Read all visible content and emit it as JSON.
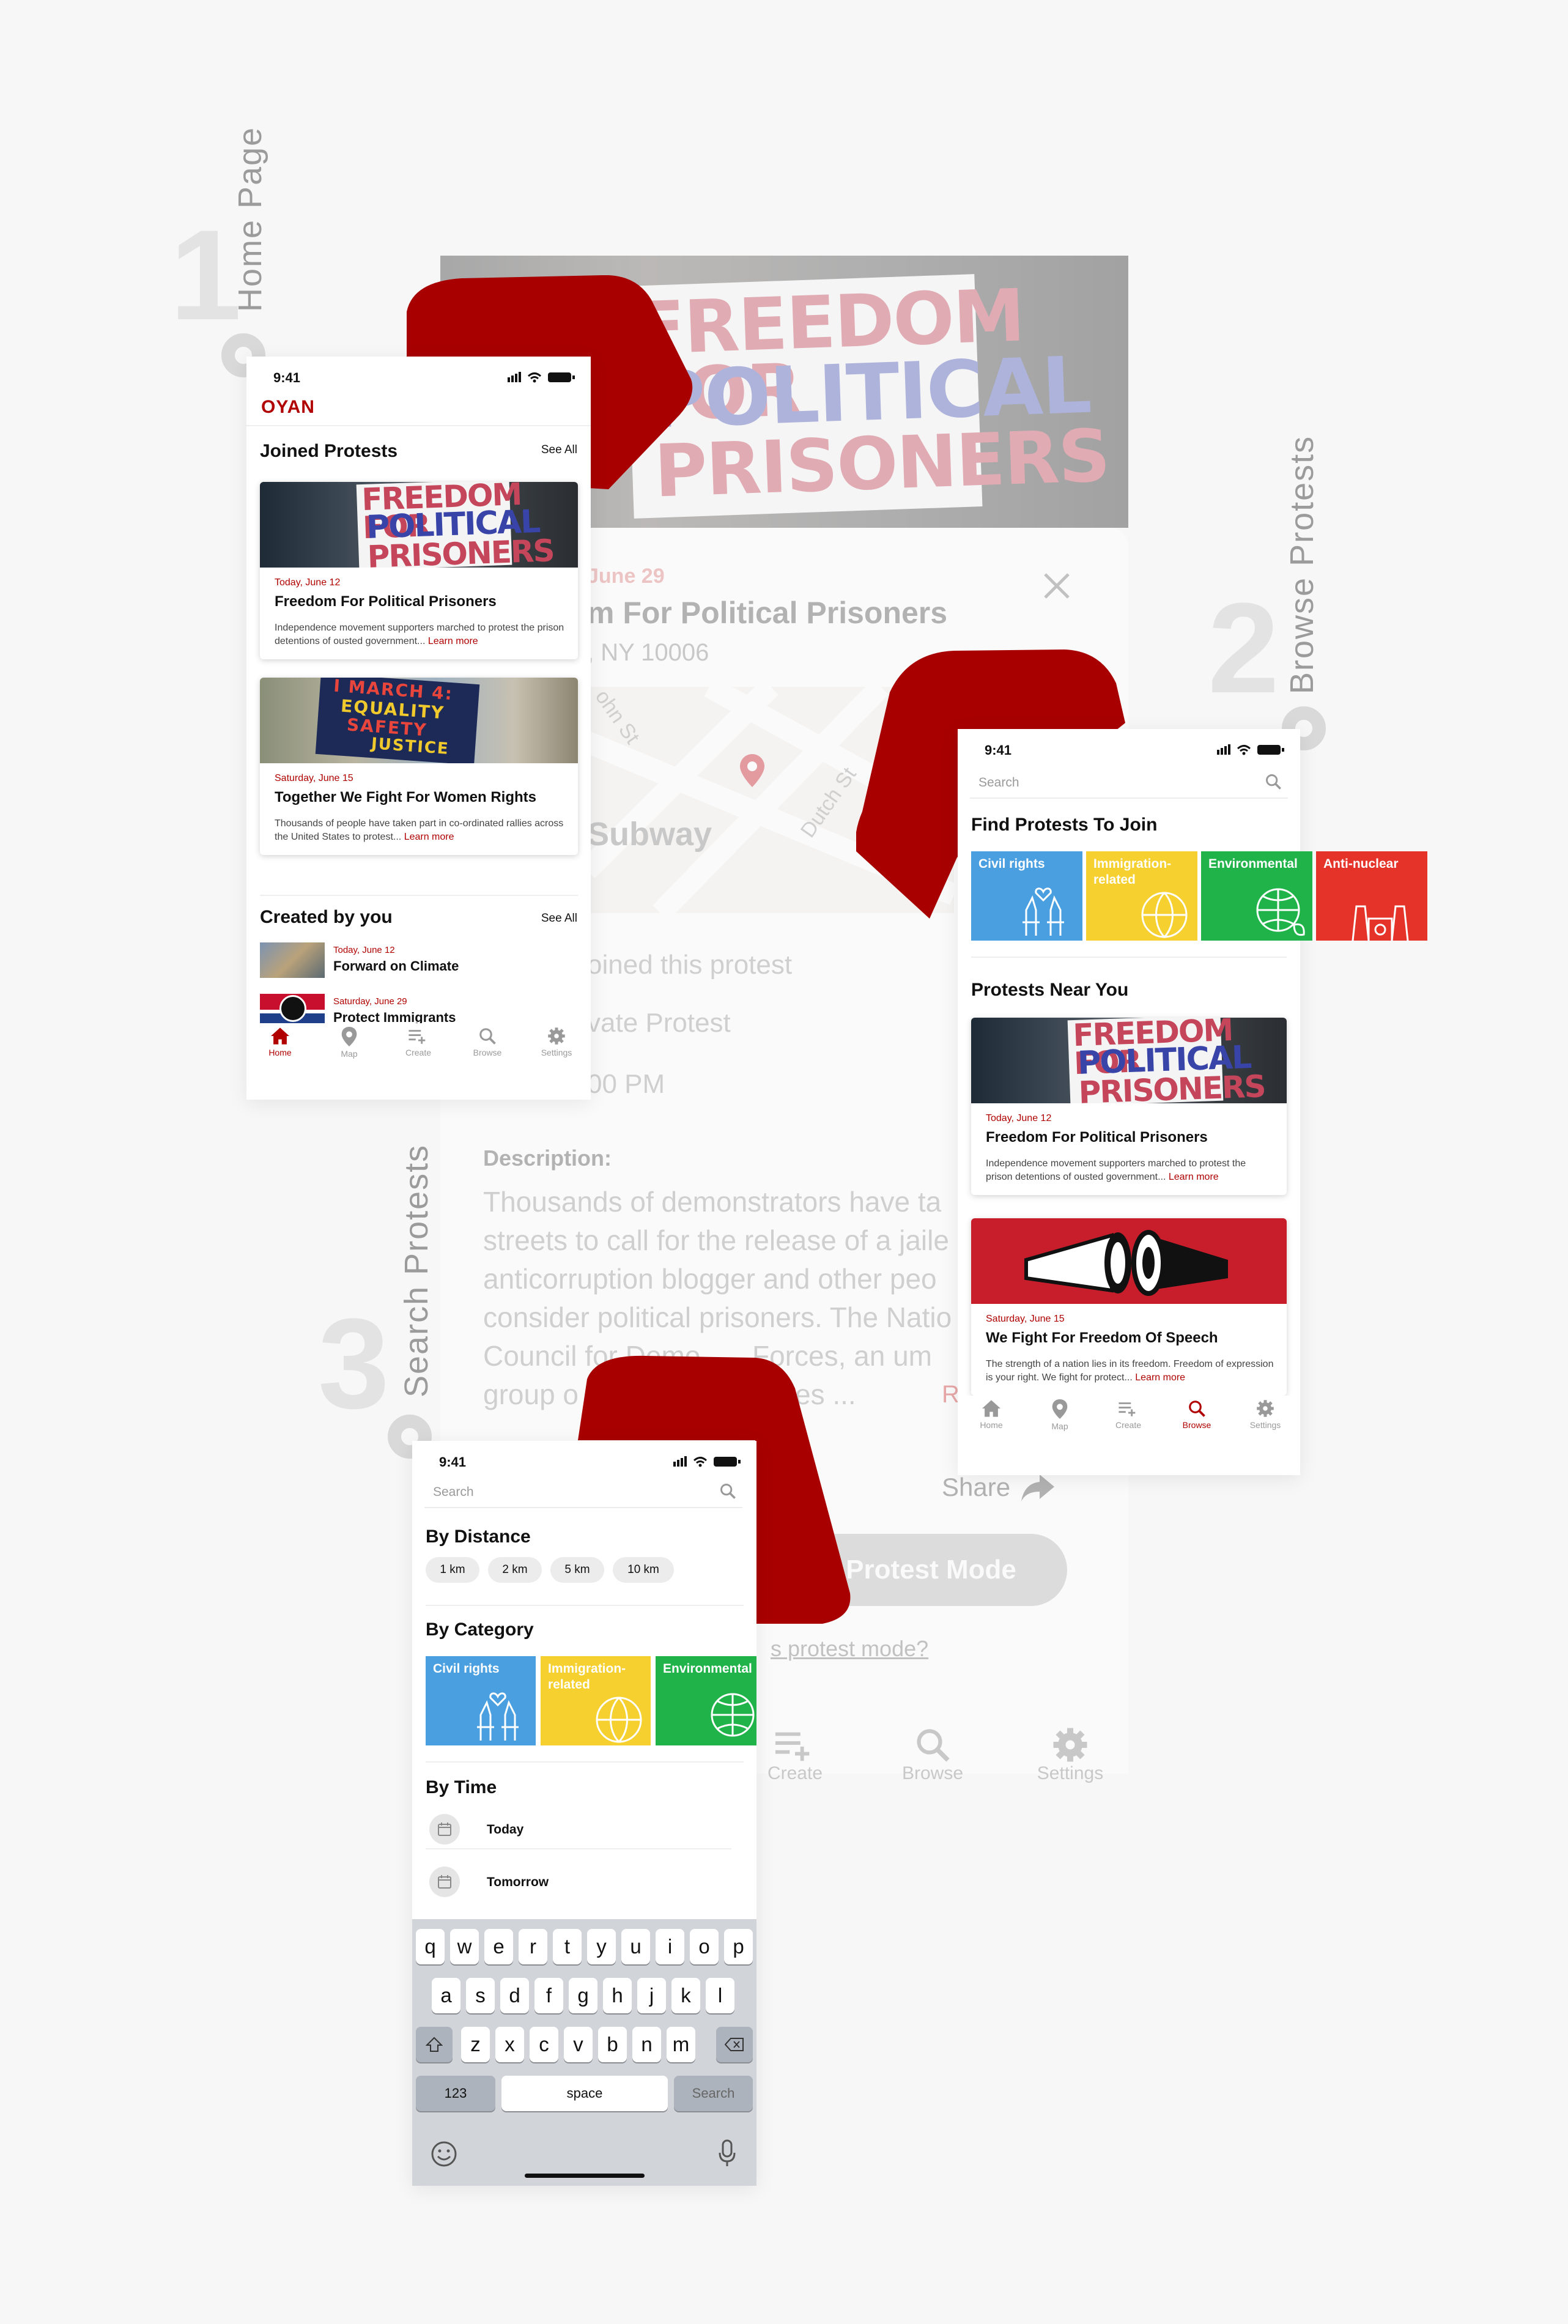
{
  "steps": [
    {
      "number": "1",
      "label": "Home Page"
    },
    {
      "number": "2",
      "label": "Browse Protests"
    },
    {
      "number": "3",
      "label": "Search Protests"
    }
  ],
  "detail": {
    "sign_lines": [
      "FREEDOM FOR",
      "POLITICAL",
      "PRISONERS"
    ],
    "date_fragment": "June 29",
    "title_fragment": "m For Political Prisoners",
    "address_fragment": ", NY 10006",
    "map_labels": {
      "street1": "ohn St",
      "street2": "Dutch St",
      "subway": "Subway"
    },
    "joined_fragment": "oined this protest",
    "private_fragment": "vate Protest",
    "time_fragment": "00 PM",
    "description_label": "Description:",
    "description_lines": [
      "Thousands of demonstrators have ta",
      "streets to call for the release of a jaile",
      "anticorruption blogger and other peo",
      "consider political prisoners. The Natio",
      "Council for Demo",
      "Forces, an um",
      "group o",
      "es ..."
    ],
    "read_more_fragment": "R",
    "share": "Share",
    "protest_mode_button": "Protest Mode",
    "protest_mode_link_fragment": "s protest mode?",
    "tabs": [
      "Create",
      "Browse",
      "Settings"
    ]
  },
  "home": {
    "status_time": "9:41",
    "logo": "OYAN",
    "joined_title": "Joined Protests",
    "joined_see_all": "See All",
    "joined_cards": [
      {
        "sign": [
          "FREEDOM FOR",
          "POLITICAL",
          "PRISONERS"
        ],
        "date": "Today, June 12",
        "title": "Freedom For Political Prisoners",
        "desc": "Independence movement supporters marched to protest the prison detentions of ousted government...",
        "learn": "Learn more"
      },
      {
        "sign": [
          "I MARCH 4:",
          "EQUALITY",
          "SAFETY",
          "JUSTICE"
        ],
        "date": "Saturday, June 15",
        "title": "Together We Fight For Women Rights",
        "desc": "Thousands of people have taken part in co-ordinated rallies across the United States to protest...",
        "learn": "Learn more"
      }
    ],
    "created_title": "Created by you",
    "created_see_all": "See All",
    "created_items": [
      {
        "date": "Today, June 12",
        "title": "Forward on Climate"
      },
      {
        "date": "Saturday, June 29",
        "title": "Protect Immigrants"
      }
    ],
    "tabs": [
      "Home",
      "Map",
      "Create",
      "Browse",
      "Settings"
    ]
  },
  "browse": {
    "status_time": "9:41",
    "search_placeholder": "Search",
    "find_title": "Find Protests To Join",
    "categories": [
      {
        "label": "Civil rights",
        "color": "#4a9fe0"
      },
      {
        "label": "Immigration-related",
        "color": "#f5d02e"
      },
      {
        "label": "Environmental",
        "color": "#20b34a"
      },
      {
        "label": "Anti-nuclear",
        "color": "#e5332a"
      }
    ],
    "near_title": "Protests Near You",
    "cards": [
      {
        "sign": [
          "FREEDOM FOR",
          "POLITICAL",
          "PRISONERS"
        ],
        "date": "Today, June 12",
        "title": "Freedom For Political Prisoners",
        "desc": "Independence movement supporters marched to protest the prison detentions of ousted government...",
        "learn": "Learn more"
      },
      {
        "date": "Saturday, June 15",
        "title": "We Fight For Freedom Of Speech",
        "desc": "The strength of a nation lies in its freedom. Freedom of expression is your right. We fight for protect...",
        "learn": "Learn more"
      }
    ],
    "tabs": [
      "Home",
      "Map",
      "Create",
      "Browse",
      "Settings"
    ]
  },
  "search": {
    "status_time": "9:41",
    "search_placeholder": "Search",
    "distance_title": "By Distance",
    "distances": [
      "1 km",
      "2 km",
      "5 km",
      "10 km"
    ],
    "category_title": "By Category",
    "categories": [
      {
        "label": "Civil rights",
        "color": "#4a9fe0"
      },
      {
        "label": "Immigration-related",
        "color": "#f5d02e"
      },
      {
        "label": "Environmental",
        "color": "#20b34a"
      }
    ],
    "time_title": "By Time",
    "times": [
      "Today",
      "Tomorrow"
    ],
    "keyboard": {
      "row1": [
        "q",
        "w",
        "e",
        "r",
        "t",
        "y",
        "u",
        "i",
        "o",
        "p"
      ],
      "row2": [
        "a",
        "s",
        "d",
        "f",
        "g",
        "h",
        "j",
        "k",
        "l"
      ],
      "row3": [
        "z",
        "x",
        "c",
        "v",
        "b",
        "n",
        "m"
      ],
      "numbers": "123",
      "space": "space",
      "search": "Search"
    }
  },
  "colors": {
    "brand": "#b00000",
    "accent": "#a80000"
  }
}
